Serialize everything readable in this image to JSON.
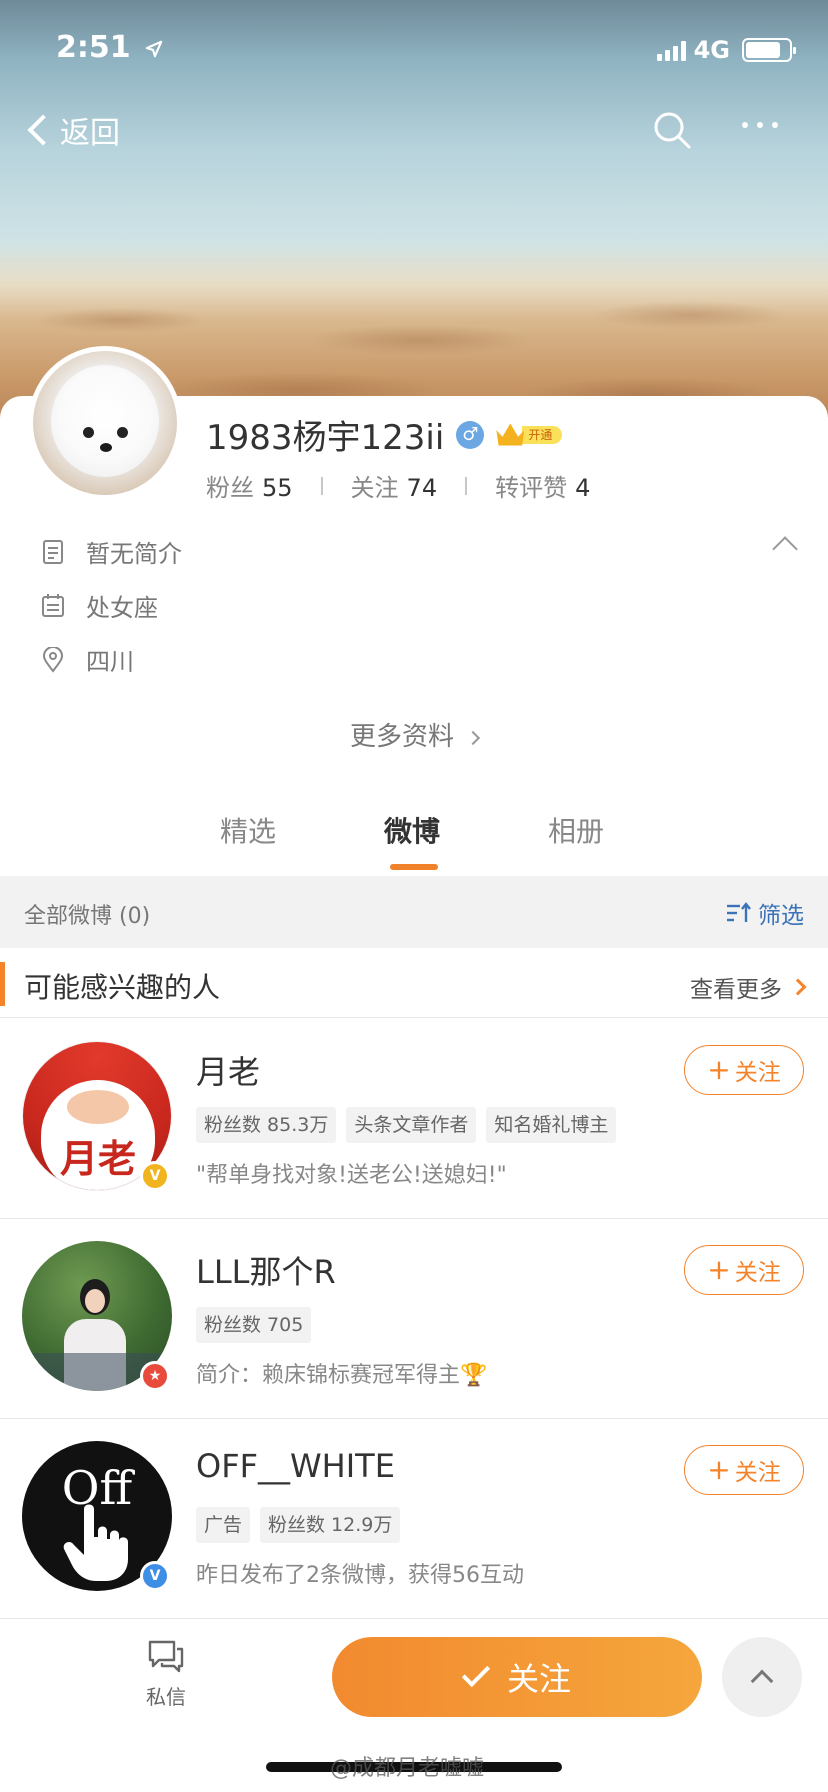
{
  "status_bar": {
    "time": "2:51",
    "network": "4G"
  },
  "nav": {
    "back_label": "返回"
  },
  "profile": {
    "username": "1983杨宇123ii",
    "gender_symbol": "♂",
    "vip_label": "开通",
    "stats": [
      {
        "label": "粉丝",
        "value": "55"
      },
      {
        "label": "关注",
        "value": "74"
      },
      {
        "label": "转评赞",
        "value": "4"
      }
    ],
    "bio": "暂无简介",
    "zodiac": "处女座",
    "location": "四川",
    "more_info": "更多资料"
  },
  "tabs": [
    {
      "label": "精选",
      "active": false
    },
    {
      "label": "微博",
      "active": true
    },
    {
      "label": "相册",
      "active": false
    }
  ],
  "feed_filter": {
    "label": "全部微博 (0)",
    "filter_label": "筛选"
  },
  "suggestions": {
    "title": "可能感兴趣的人",
    "see_more": "查看更多",
    "people": [
      {
        "name": "月老",
        "badge": "V",
        "badge_color": "#f2b41e",
        "tags": [
          "粉丝数 85.3万",
          "头条文章作者",
          "知名婚礼博主"
        ],
        "desc": "\"帮单身找对象!送老公!送媳妇!\"",
        "follow_label": "关注",
        "avatar_text": "月老"
      },
      {
        "name": "LLL那个R",
        "badge": "★",
        "badge_color": "#e84b3c",
        "tags": [
          "粉丝数 705"
        ],
        "desc": "简介：赖床锦标赛冠军得主🏆",
        "follow_label": "关注",
        "avatar_text": ""
      },
      {
        "name": "OFF__WHITE",
        "badge": "V",
        "badge_color": "#3f8ee5",
        "tags": [
          "广告",
          "粉丝数 12.9万"
        ],
        "desc": "昨日发布了2条微博，获得56互动",
        "follow_label": "关注",
        "avatar_text": "Off"
      }
    ]
  },
  "bottom_bar": {
    "dm_label": "私信",
    "follow_label": "关注",
    "watermark": "@成都月老嘘嘘"
  },
  "colors": {
    "accent": "#f5832a",
    "link": "#3b72b8"
  }
}
